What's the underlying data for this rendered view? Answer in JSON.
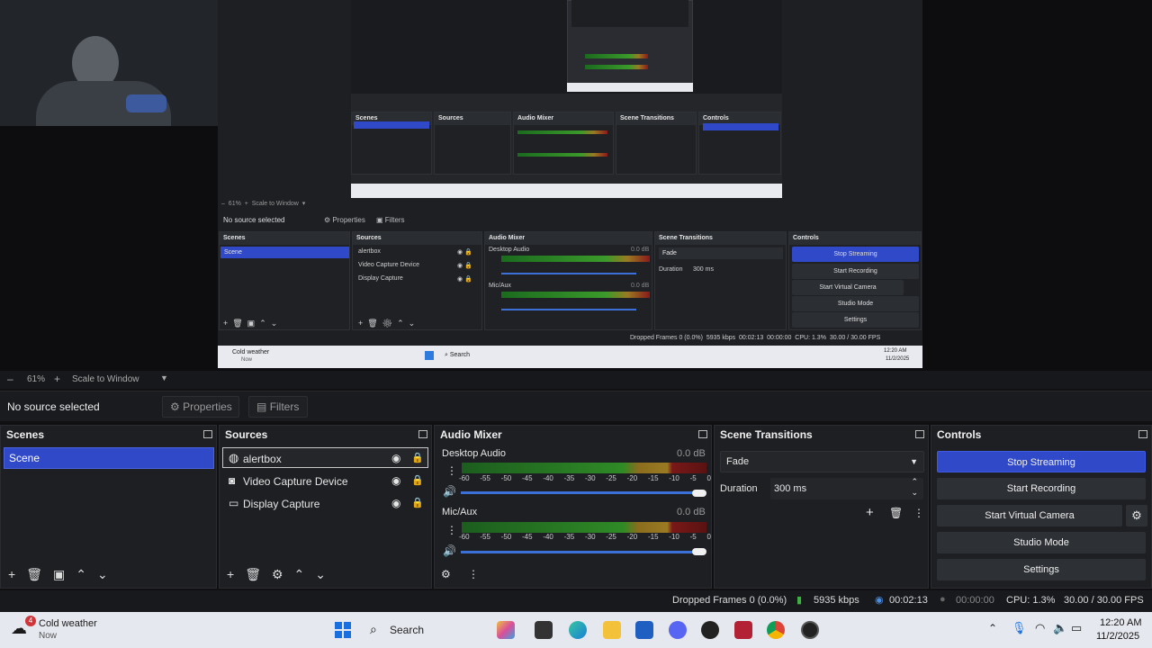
{
  "preview": {
    "nested_toolbar": {
      "zoom": "61%",
      "scale": "Scale to Window"
    },
    "nested_source_label": "No source selected",
    "nested_properties": "Properties",
    "nested_filters": "Filters",
    "nested_scenes_title": "Scenes",
    "nested_scene_item": "Scene",
    "nested_sources_title": "Sources",
    "nested_sources": [
      "alertbox",
      "Video Capture Device",
      "Display Capture"
    ],
    "nested_mixer_title": "Audio Mixer",
    "nested_desktop_audio": "Desktop Audio",
    "nested_mic": "Mic/Aux",
    "nested_db": "0.0 dB",
    "nested_transitions_title": "Scene Transitions",
    "nested_fade": "Fade",
    "nested_duration_label": "Duration",
    "nested_duration": "300 ms",
    "nested_controls_title": "Controls",
    "nested_controls": [
      "Stop Streaming",
      "Start Recording",
      "Start Virtual Camera",
      "Studio Mode",
      "Settings"
    ],
    "nested_status": {
      "dropped": "Dropped Frames 0 (0.0%)",
      "kbps": "5935 kbps",
      "time1": "00:02:13",
      "time2": "00:00:00",
      "cpu": "CPU: 1.3%",
      "fps": "30.00 / 30.00 FPS"
    },
    "nested_weather": {
      "title": "Cold weather",
      "sub": "Now"
    },
    "nested_search": "Search",
    "nested_clock": {
      "time": "12:20 AM",
      "date": "11/2/2025"
    },
    "inner_zoom": "61%",
    "inner_scale": "Scale to Window",
    "inner_no_source": "No source selected"
  },
  "toolbar": {
    "zoom": "61%",
    "scale_mode": "Scale to Window"
  },
  "source_bar": {
    "label": "No source selected",
    "properties": "Properties",
    "filters": "Filters"
  },
  "scenes": {
    "title": "Scenes",
    "items": [
      "Scene"
    ]
  },
  "sources": {
    "title": "Sources",
    "items": [
      "alertbox",
      "Video Capture Device",
      "Display Capture"
    ]
  },
  "mixer": {
    "title": "Audio Mixer",
    "channels": [
      {
        "name": "Desktop Audio",
        "db": "0.0 dB"
      },
      {
        "name": "Mic/Aux",
        "db": "0.0 dB"
      }
    ],
    "ticks": [
      "-60",
      "-55",
      "-50",
      "-45",
      "-40",
      "-35",
      "-30",
      "-25",
      "-20",
      "-15",
      "-10",
      "-5",
      "0"
    ]
  },
  "transitions": {
    "title": "Scene Transitions",
    "selected": "Fade",
    "duration_label": "Duration",
    "duration": "300 ms"
  },
  "controls": {
    "title": "Controls",
    "stop_streaming": "Stop Streaming",
    "start_recording": "Start Recording",
    "start_virtual_camera": "Start Virtual Camera",
    "studio_mode": "Studio Mode",
    "settings": "Settings"
  },
  "status": {
    "dropped": "Dropped Frames 0 (0.0%)",
    "kbps": "5935 kbps",
    "stream_time": "00:02:13",
    "rec_time": "00:00:00",
    "cpu": "CPU: 1.3%",
    "fps": "30.00 / 30.00 FPS"
  },
  "taskbar": {
    "weather_title": "Cold weather",
    "weather_sub": "Now",
    "weather_badge": "4",
    "search": "Search",
    "time": "12:20 AM",
    "date": "11/2/2025"
  },
  "colors": {
    "accent": "#2f49c8",
    "panel": "#1e1f23",
    "taskbar": "#e6e8ef"
  }
}
